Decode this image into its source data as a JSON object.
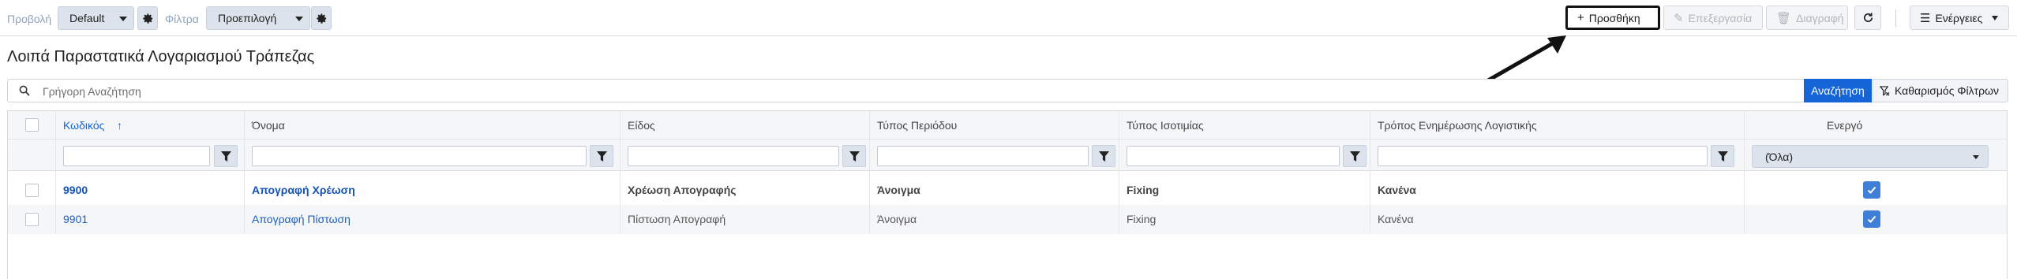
{
  "toolbar": {
    "view_label": "Προβολή",
    "view_value": "Default",
    "filters_label": "Φίλτρα",
    "filters_value": "Προεπιλογή",
    "add_label": "Προσθήκη",
    "edit_label": "Επεξεργασία",
    "delete_label": "Διαγραφή",
    "actions_label": "Ενέργειες"
  },
  "page": {
    "title": "Λοιπά Παραστατικά Λογαριασμού Τράπεζας"
  },
  "search": {
    "placeholder": "Γρήγορη Αναζήτηση",
    "search_button": "Αναζήτηση",
    "clear_button": "Καθαρισμός Φίλτρων"
  },
  "grid": {
    "columns": [
      "Κωδικός",
      "Όνομα",
      "Είδος",
      "Τύπος Περιόδου",
      "Τύπος Ισοτιμίας",
      "Τρόπος Ενημέρωσης Λογιστικής",
      "Ενεργό"
    ],
    "sort_indicator": "↑",
    "active_filter_value": "(Όλα)",
    "rows": [
      [
        "9900",
        "Απογραφή Χρέωση",
        "Χρέωση Απογραφής",
        "Άνοιγμα",
        "Fixing",
        "Κανένα"
      ],
      [
        "9901",
        "Απογραφή Πίστωση",
        "Πίστωση Απογραφή",
        "Άνοιγμα",
        "Fixing",
        "Κανένα"
      ]
    ],
    "active": [
      true,
      true
    ]
  },
  "colors": {
    "primary": "#1565d8",
    "link": "#1e5fbf",
    "checkbox_on": "#3f7fd8"
  }
}
